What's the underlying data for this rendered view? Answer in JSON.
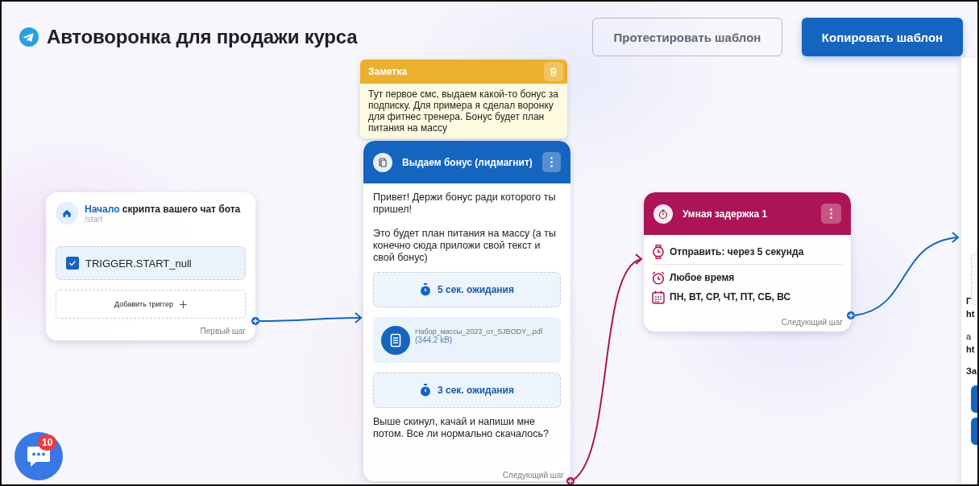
{
  "title": "Автоворонка для продажи курса",
  "buttons": [
    {
      "label": "Протестировать шаблон",
      "kind": "outline"
    },
    {
      "label": "Копировать шаблон",
      "kind": "primary"
    }
  ],
  "start": {
    "title_accent": "Начало",
    "title": "скрипта вашего чат бота",
    "command": "/start",
    "triggers": [
      {
        "label": "TRIGGER.START_null",
        "checked": true
      }
    ],
    "add_trigger": "Добавить триггер",
    "next_label": "Первый шаг"
  },
  "note": {
    "title": "Заметка",
    "text": "Тут первое смс, выдаем какой-то бонус за подписку. Для примера я сделал воронку для фитнес тренера. Бонус будет план питания на массу"
  },
  "steps": [
    {
      "kind": "message",
      "title": "Выдаем бонус (лидмагнит)",
      "color": "#1565c0",
      "next_label": "Следующий шаг",
      "items": [
        {
          "kind": "text",
          "text": "Привет! Держи бонус ради которого ты пришел!"
        },
        {
          "kind": "text",
          "text": "Это будет план питания на массу (а ты конечно сюда приложи свой текст и свой бонус)"
        },
        {
          "kind": "wait",
          "text": "5 сек. ожидания"
        },
        {
          "kind": "file",
          "name": "Набор_массы_2023_от_SJBODY_.pdf",
          "size": "(344.2 kB)"
        },
        {
          "kind": "wait",
          "text": "3 сек. ожидания"
        },
        {
          "kind": "text",
          "text": "Выше скинул, качай и напиши мне потом. Все ли нормально скачалось?"
        }
      ]
    },
    {
      "kind": "delay",
      "title": "Умная задержка 1",
      "color": "#ad1457",
      "next_label": "Следующий шаг",
      "items": [
        {
          "kind": "send",
          "text": "Отправить: через 5 секунда"
        },
        {
          "kind": "time",
          "text": "Любое время"
        },
        {
          "kind": "days",
          "text": "ПН, ВТ, СР, ЧТ, ПТ, СБ, ВС"
        }
      ]
    }
  ],
  "side_panel": {
    "texts": [
      "Г",
      "ht",
      "а",
      "ht",
      "За"
    ]
  },
  "chat": {
    "badge": "10"
  }
}
